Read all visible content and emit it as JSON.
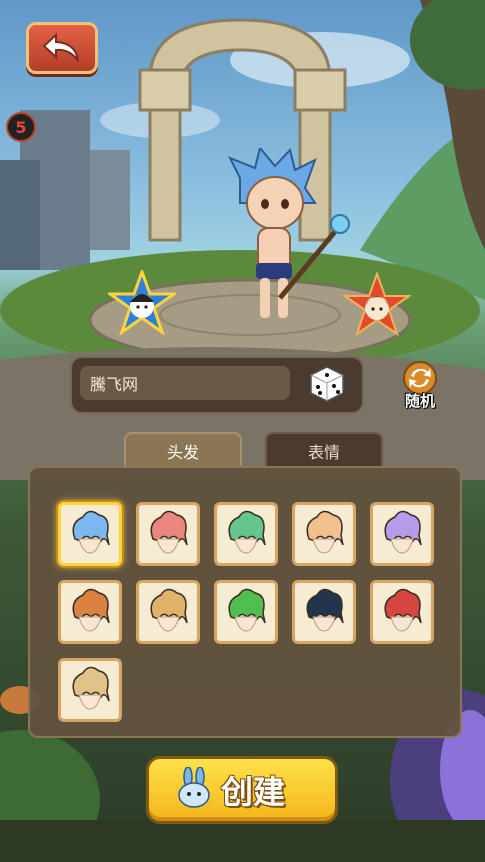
{
  "energy_badge": "5",
  "nickname": {
    "value": "騰飞网"
  },
  "random_button": {
    "label": "随机"
  },
  "tabs": [
    {
      "label": "头发",
      "active": true
    },
    {
      "label": "表情",
      "active": false
    }
  ],
  "hair_options": [
    {
      "color": "#7ab8ef",
      "selected": true
    },
    {
      "color": "#e9867e",
      "selected": false
    },
    {
      "color": "#66c48e",
      "selected": false
    },
    {
      "color": "#f2c08c",
      "selected": false
    },
    {
      "color": "#b59be9",
      "selected": false
    },
    {
      "color": "#d98242",
      "selected": false
    },
    {
      "color": "#e1b36a",
      "selected": false
    },
    {
      "color": "#4fbf4f",
      "selected": false
    },
    {
      "color": "#23344d",
      "selected": false
    },
    {
      "color": "#d7463e",
      "selected": false
    },
    {
      "color": "#e1c28a",
      "selected": false
    }
  ],
  "create_button": {
    "label": "创建"
  },
  "colors": {
    "accent": "#f4b51a",
    "back_button": "#d0543a",
    "panel": "#62523e"
  }
}
